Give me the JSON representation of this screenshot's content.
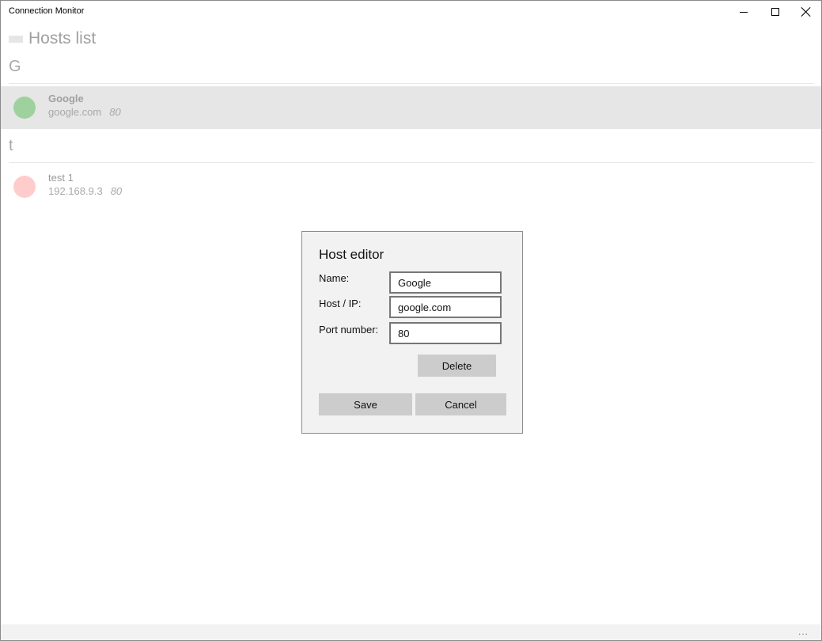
{
  "window": {
    "title": "Connection Monitor"
  },
  "header": {
    "title": "Hosts list",
    "menu_icon": "hamburger-icon"
  },
  "groups": [
    {
      "letter": "G",
      "hosts": [
        {
          "name": "Google",
          "address": "google.com",
          "port": "80",
          "status_color": "#9fd19f",
          "selected": true
        }
      ]
    },
    {
      "letter": "t",
      "hosts": [
        {
          "name": "test 1",
          "address": "192.168.9.3",
          "port": "80",
          "status_color": "#ffcccc",
          "selected": false
        }
      ]
    }
  ],
  "dialog": {
    "title": "Host editor",
    "name_label": "Name:",
    "name_value": "Google",
    "host_label": "Host / IP:",
    "host_value": "google.com",
    "port_label": "Port number:",
    "port_value": "80",
    "delete_label": "Delete",
    "save_label": "Save",
    "cancel_label": "Cancel"
  },
  "appbar": {
    "more_glyph": "..."
  }
}
